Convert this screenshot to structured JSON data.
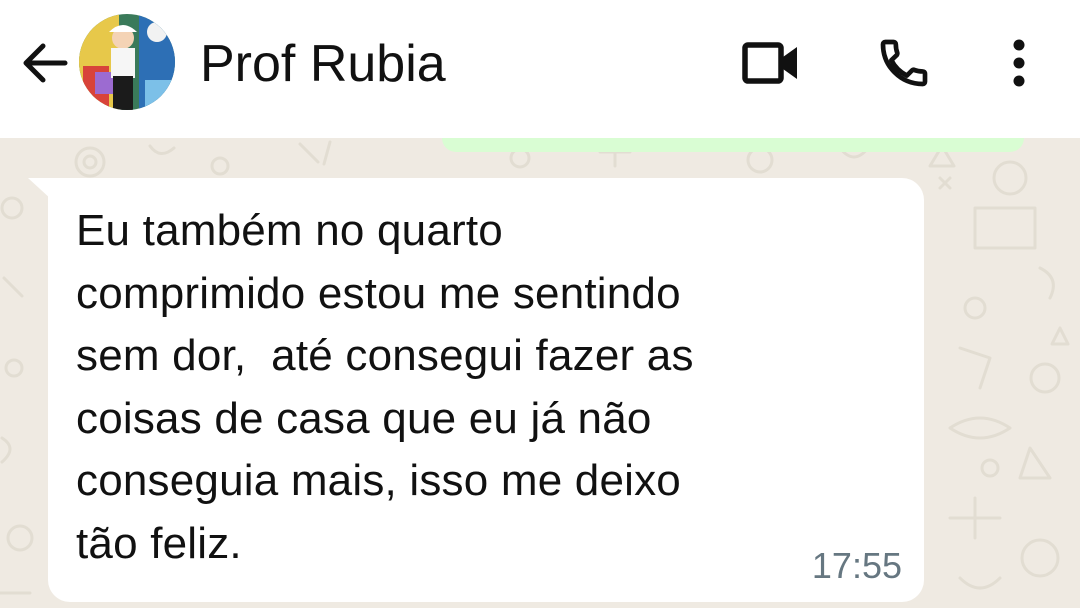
{
  "header": {
    "contact_name": "Prof Rubia",
    "icons": {
      "back": "arrow-left-icon",
      "avatar": "avatar",
      "video": "video-camera-icon",
      "call": "phone-icon",
      "more": "more-vertical-icon"
    }
  },
  "chat": {
    "message": {
      "text": "Eu também no quarto\ncomprimido estou me sentindo\nsem dor,  até consegui fazer as\ncoisas de casa que eu já não\nconseguia mais, isso me deixo\ntão feliz.",
      "time": "17:55"
    }
  },
  "colors": {
    "header_bg": "#ffffff",
    "chat_bg": "#efeae2",
    "incoming_bubble": "#ffffff",
    "outgoing_bubble": "#d9fdd3",
    "timestamp": "#667781",
    "icon": "#111111"
  }
}
